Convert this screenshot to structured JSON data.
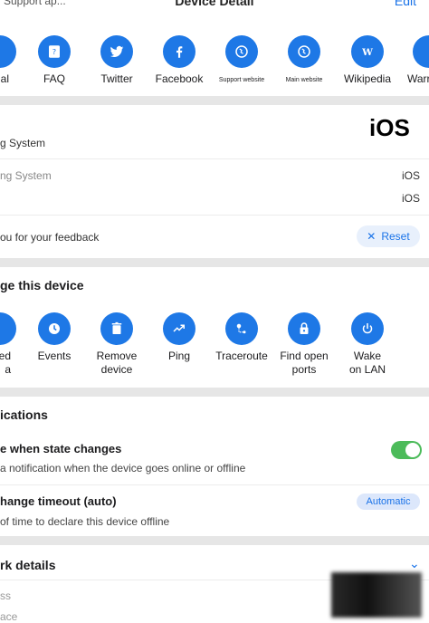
{
  "nav": {
    "title": "Device Detail",
    "edit_label": "Edit",
    "clipped_top_text": "Support ap..."
  },
  "links": [
    {
      "label": "al",
      "icon": "partial-icon"
    },
    {
      "label": "FAQ",
      "icon": "faq-icon"
    },
    {
      "label": "Twitter",
      "icon": "twitter-icon"
    },
    {
      "label": "Facebook",
      "icon": "facebook-icon"
    },
    {
      "label": "Support website",
      "icon": "globe-icon"
    },
    {
      "label": "Main website",
      "icon": "globe-icon"
    },
    {
      "label": "Wikipedia",
      "icon": "wikipedia-icon"
    },
    {
      "label": "Warr",
      "icon": "partial-icon"
    }
  ],
  "os": {
    "logo_text": "iOS",
    "title": "g System",
    "rows": [
      {
        "label": "ng System",
        "value": "iOS"
      },
      {
        "label": "",
        "value": "iOS"
      }
    ],
    "feedback_text": "ou for your feedback",
    "reset_label": "Reset"
  },
  "manage": {
    "heading": "ge this device",
    "actions": [
      {
        "label": "ed\na",
        "icon": "partial-icon"
      },
      {
        "label": "Events",
        "icon": "clock-icon"
      },
      {
        "label": "Remove\ndevice",
        "icon": "trash-icon"
      },
      {
        "label": "Ping",
        "icon": "trend-icon"
      },
      {
        "label": "Traceroute",
        "icon": "route-icon"
      },
      {
        "label": "Find open\nports",
        "icon": "lock-icon"
      },
      {
        "label": "Wake\non LAN",
        "icon": "power-icon"
      }
    ]
  },
  "notifications": {
    "heading": "ications",
    "state_change_title": "e when state changes",
    "state_change_desc": "a notification when the device goes online or offline",
    "state_change_on": true,
    "timeout_title": "hange timeout (auto)",
    "timeout_desc": " of time to declare this device offline",
    "timeout_badge": "Automatic"
  },
  "network": {
    "heading": "rk details",
    "row1_label": "ss",
    "row2_label": "ace"
  },
  "colors": {
    "accent": "#1e78e6",
    "toggle_on": "#4cbb5a",
    "separator": "#e6e6e6"
  }
}
